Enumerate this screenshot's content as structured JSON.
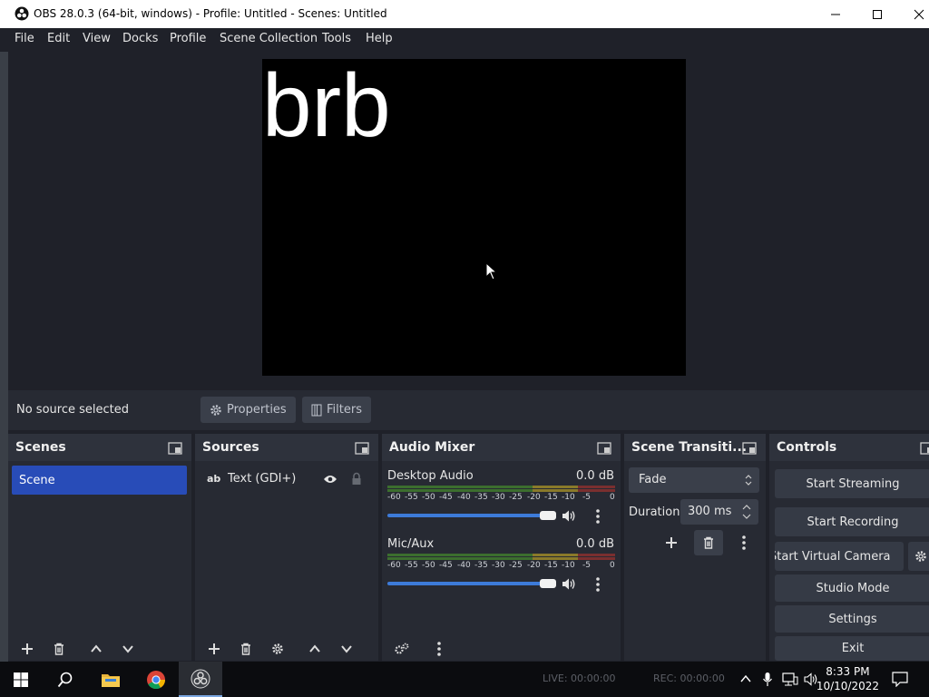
{
  "window": {
    "title": "OBS 28.0.3 (64-bit, windows) - Profile: Untitled - Scenes: Untitled"
  },
  "menu": [
    "File",
    "Edit",
    "View",
    "Docks",
    "Profile",
    "Scene Collection",
    "Tools",
    "Help"
  ],
  "preview": {
    "text": "brb"
  },
  "status": {
    "no_source": "No source selected",
    "properties": "Properties",
    "filters": "Filters"
  },
  "docks": {
    "scenes": {
      "title": "Scenes",
      "items": [
        "Scene"
      ]
    },
    "sources": {
      "title": "Sources",
      "items": [
        {
          "type": "ab",
          "name": "Text (GDI+)"
        }
      ]
    },
    "audio": {
      "title": "Audio Mixer",
      "scale": [
        "-60",
        "-55",
        "-50",
        "-45",
        "-40",
        "-35",
        "-30",
        "-25",
        "-20",
        "-15",
        "-10",
        "-5",
        "0"
      ],
      "channels": [
        {
          "name": "Desktop Audio",
          "db": "0.0 dB",
          "volume": 1.0
        },
        {
          "name": "Mic/Aux",
          "db": "0.0 dB",
          "volume": 1.0
        }
      ]
    },
    "transitions": {
      "title": "Scene Transiti...",
      "type": "Fade",
      "duration_label": "Duration",
      "duration": "300 ms"
    },
    "controls": {
      "title": "Controls",
      "buttons": [
        "Start Streaming",
        "Start Recording",
        "Start Virtual Camera",
        "Studio Mode",
        "Settings",
        "Exit"
      ]
    }
  },
  "taskbar": {
    "live": "LIVE: 00:00:00",
    "rec": "REC: 00:00:00",
    "time": "8:33 PM",
    "date": "10/10/2022"
  },
  "colors": {
    "accent": "#284cb8",
    "panel": "#272a33",
    "background": "#1f2129",
    "slider": "#3d7bd9"
  }
}
